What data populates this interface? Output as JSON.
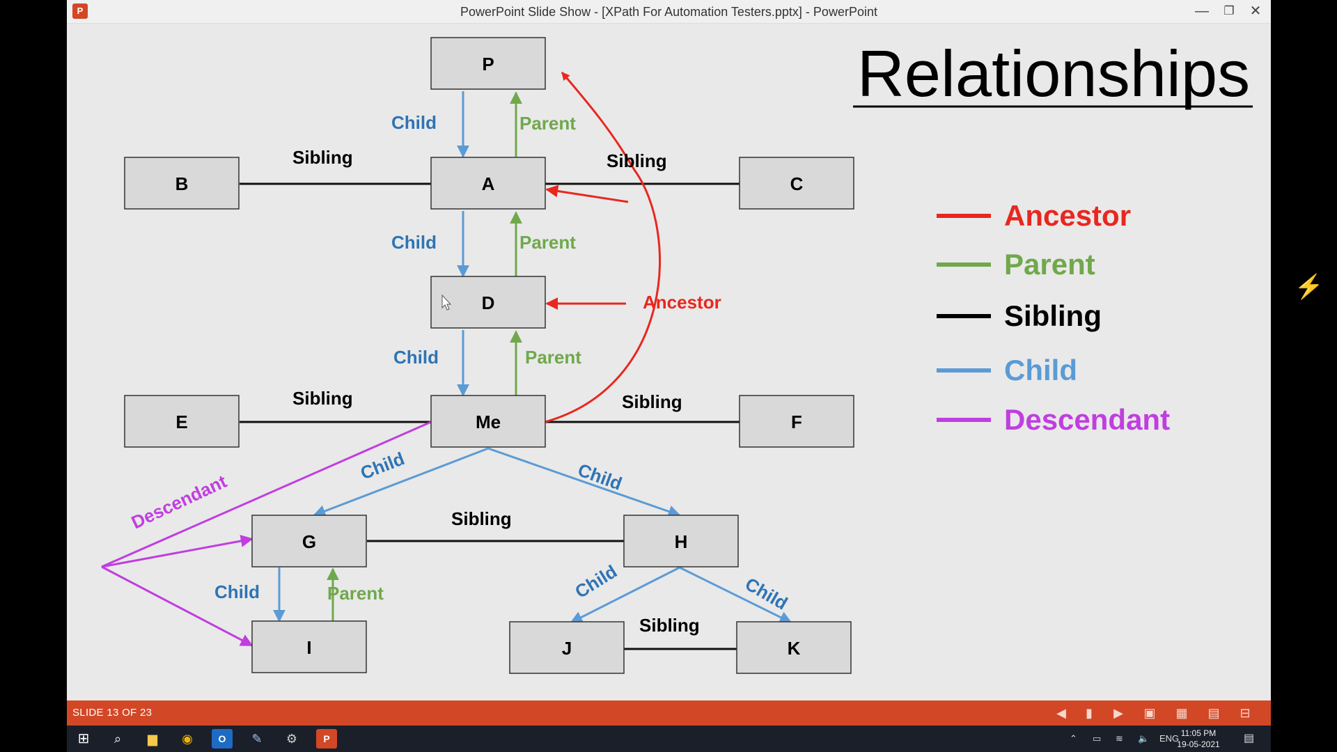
{
  "window": {
    "title": "PowerPoint Slide Show - [XPath For Automation Testers.pptx] - PowerPoint",
    "app_icon": "P"
  },
  "slide": {
    "title": "Relationships",
    "nodes": [
      "P",
      "B",
      "A",
      "C",
      "D",
      "E",
      "Me",
      "F",
      "G",
      "H",
      "I",
      "J",
      "K"
    ],
    "labels": {
      "child": "Child",
      "parent": "Parent",
      "sibling": "Sibling",
      "ancestor": "Ancestor",
      "descendant": "Descendant"
    },
    "legend": [
      {
        "label": "Ancestor",
        "color": "#e8271f"
      },
      {
        "label": "Parent",
        "color": "#70a84c"
      },
      {
        "label": "Sibling",
        "color": "#000000"
      },
      {
        "label": "Child",
        "color": "#5b9bd5"
      },
      {
        "label": "Descendant",
        "color": "#c03ee0"
      }
    ]
  },
  "statusbar": {
    "slide_counter": "SLIDE 13 OF 23"
  },
  "taskbar": {
    "lang": "ENG",
    "time": "11:05 PM",
    "date": "19-05-2021"
  }
}
